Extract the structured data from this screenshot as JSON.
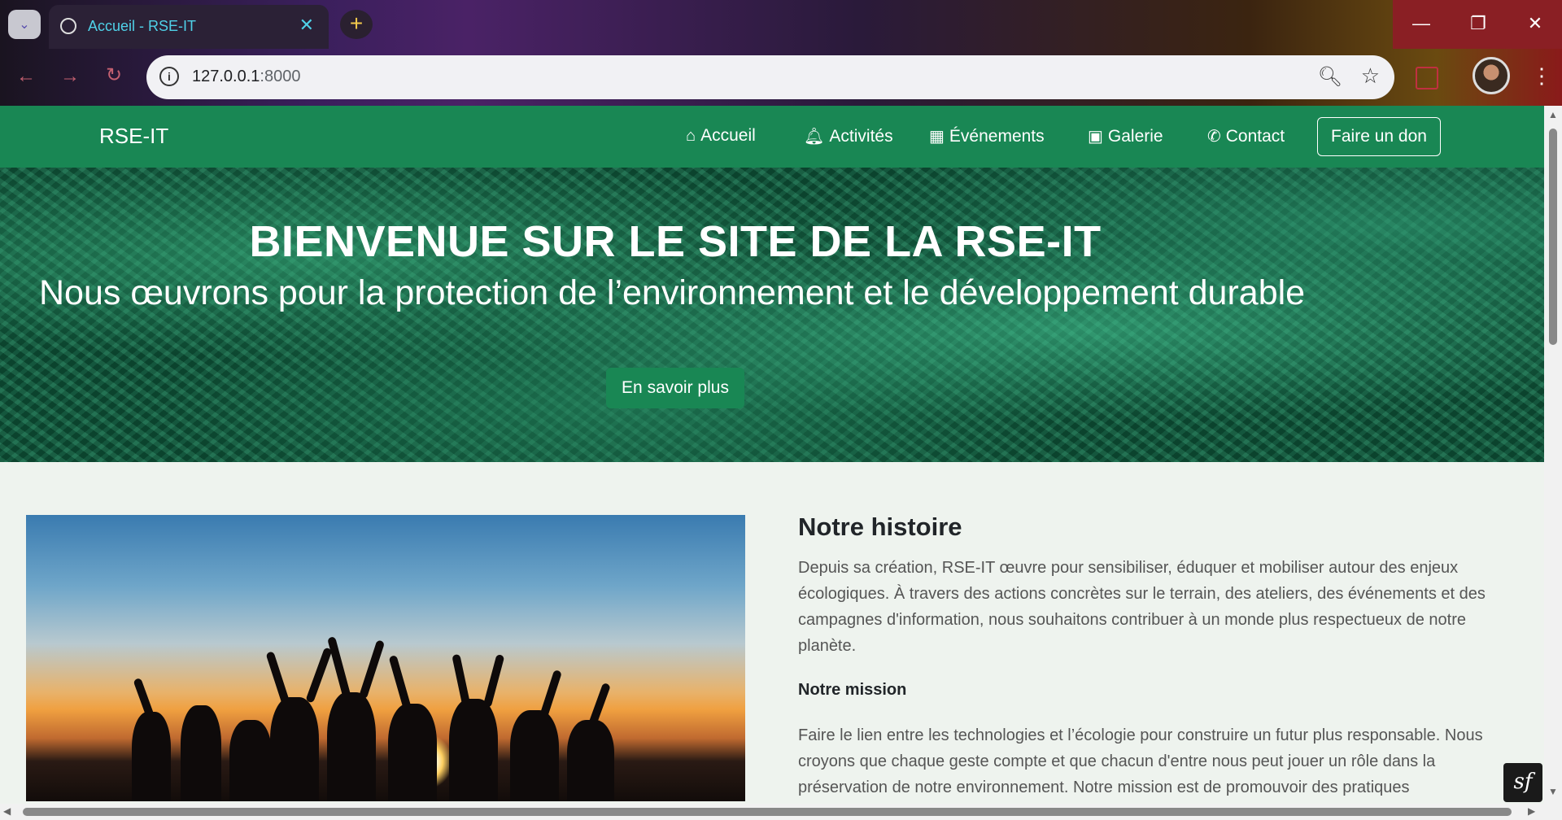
{
  "browser": {
    "tab_title": "Accueil - RSE-IT",
    "tab_close": "✕",
    "new_tab": "+",
    "url_host": "127.0.0.1",
    "url_port": ":8000",
    "window_min": "—",
    "window_max": "❐",
    "window_close": "✕",
    "back": "←",
    "forward": "→",
    "reload": "↻"
  },
  "site": {
    "brand": "RSE-IT",
    "nav": [
      {
        "label": "Accueil",
        "icon": "home-icon"
      },
      {
        "label": "Activités",
        "icon": "bell-icon"
      },
      {
        "label": "Événements",
        "icon": "calendar-icon"
      },
      {
        "label": "Galerie",
        "icon": "image-icon"
      },
      {
        "label": "Contact",
        "icon": "phone-icon"
      }
    ],
    "donate_label": "Faire un don"
  },
  "hero": {
    "title": "BIENVENUE SUR LE SITE DE LA RSE-IT",
    "subtitle": "Nous œuvrons pour la protection de l’environnement et le développement durable",
    "button": "En savoir plus"
  },
  "story": {
    "heading": "Notre histoire",
    "paragraph": "Depuis sa création, RSE-IT œuvre pour sensibiliser, éduquer et mobiliser autour des enjeux écologiques. À travers des actions concrètes sur le terrain, des ateliers, des événements et des campagnes d'information, nous souhaitons contribuer à un monde plus respectueux de notre planète.",
    "mission_heading": "Notre mission",
    "mission_paragraph": "Faire le lien entre les technologies et l’écologie pour construire un futur plus responsable. Nous croyons que chaque geste compte et que chacun d'entre nous peut jouer un rôle dans la préservation de notre environnement. Notre mission est de promouvoir des pratiques"
  },
  "symfony_badge": "sf",
  "colors": {
    "brand_green": "#198754"
  }
}
